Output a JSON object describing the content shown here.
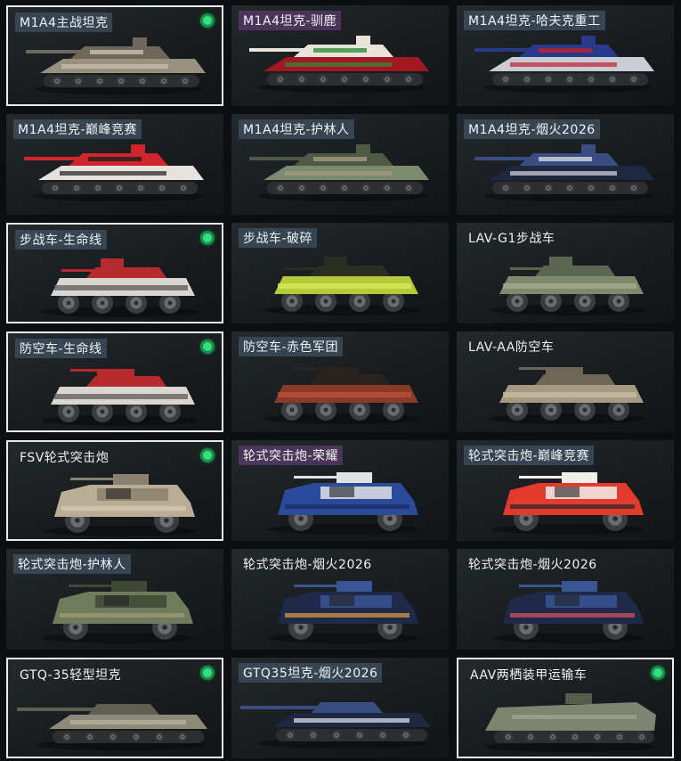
{
  "cards": [
    {
      "name": "M1A4主战坦克",
      "tag": "blue",
      "selected": true,
      "equipped": true,
      "kind": "tank",
      "body": "#9a9080",
      "accent": "#6e675c",
      "mark": "#c9c2b2"
    },
    {
      "name": "M1A4坦克-驯鹿",
      "tag": "purple",
      "selected": false,
      "equipped": false,
      "kind": "tank",
      "body": "#a11820",
      "accent": "#e8e4dc",
      "mark": "#2f8f3a"
    },
    {
      "name": "M1A4坦克-哈夫克重工",
      "tag": "blue",
      "selected": false,
      "equipped": false,
      "kind": "tank",
      "body": "#c9ccd3",
      "accent": "#2a3a8a",
      "mark": "#c02030"
    },
    {
      "name": "M1A4坦克-巅峰竞赛",
      "tag": "blue",
      "selected": false,
      "equipped": false,
      "kind": "tank",
      "body": "#e6e3de",
      "accent": "#d0262b",
      "mark": "#1e1e1e"
    },
    {
      "name": "M1A4坦克-护林人",
      "tag": "blue",
      "selected": false,
      "equipped": false,
      "kind": "tank",
      "body": "#7c8a70",
      "accent": "#4e5a45",
      "mark": "#a59a80"
    },
    {
      "name": "M1A4坦克-烟火2026",
      "tag": "blue",
      "selected": false,
      "equipped": false,
      "kind": "tank",
      "body": "#1d2740",
      "accent": "#3a4d80",
      "mark": "#d8d8e0"
    },
    {
      "name": "步战车-生命线",
      "tag": "blue",
      "selected": true,
      "equipped": true,
      "kind": "ifv",
      "body": "#d9d6d2",
      "accent": "#b52a2f",
      "mark": "#5a5a5a"
    },
    {
      "name": "步战车-破碎",
      "tag": "blue",
      "selected": false,
      "equipped": false,
      "kind": "ifv",
      "body": "#b6c93a",
      "accent": "#2a2f22",
      "mark": "#d9ea5a"
    },
    {
      "name": "LAV-G1步战车",
      "tag": "plain",
      "selected": false,
      "equipped": false,
      "kind": "ifv",
      "body": "#7f8a6c",
      "accent": "#5c6650",
      "mark": "#a6ad94"
    },
    {
      "name": "防空车-生命线",
      "tag": "blue",
      "selected": true,
      "equipped": true,
      "kind": "aa",
      "body": "#d9d6d2",
      "accent": "#b52a2f",
      "mark": "#5a5a5a"
    },
    {
      "name": "防空车-赤色军团",
      "tag": "blue",
      "selected": false,
      "equipped": false,
      "kind": "aa",
      "body": "#8a3a28",
      "accent": "#2a221e",
      "mark": "#c0503a"
    },
    {
      "name": "LAV-AA防空车",
      "tag": "plain",
      "selected": false,
      "equipped": false,
      "kind": "aa",
      "body": "#a59a82",
      "accent": "#6e6656",
      "mark": "#c8bea6"
    },
    {
      "name": "FSV轮式突击炮",
      "tag": "plain",
      "selected": true,
      "equipped": true,
      "kind": "fsv",
      "body": "#b9ad96",
      "accent": "#8a8070",
      "mark": "#d6ccb6"
    },
    {
      "name": "轮式突击炮-荣耀",
      "tag": "purple",
      "selected": false,
      "equipped": false,
      "kind": "fsv",
      "body": "#2b4a9a",
      "accent": "#e2e2e6",
      "mark": "#1a2a60"
    },
    {
      "name": "轮式突击炮-巅峰竞赛",
      "tag": "blue",
      "selected": false,
      "equipped": false,
      "kind": "fsv",
      "body": "#e23a2c",
      "accent": "#f1efea",
      "mark": "#2a2a2a"
    },
    {
      "name": "轮式突击炮-护林人",
      "tag": "blue",
      "selected": false,
      "equipped": false,
      "kind": "fsv",
      "body": "#6e7c5c",
      "accent": "#3e4834",
      "mark": "#a29878"
    },
    {
      "name": "轮式突击炮-烟火2026",
      "tag": "plain",
      "selected": false,
      "equipped": false,
      "kind": "fsv",
      "body": "#1e2a48",
      "accent": "#3b5594",
      "mark": "#e0a040"
    },
    {
      "name": "轮式突击炮-烟火2026",
      "tag": "plain",
      "selected": false,
      "equipped": false,
      "kind": "fsv",
      "body": "#1e2a48",
      "accent": "#3b5594",
      "mark": "#e05060"
    },
    {
      "name": "GTQ-35轻型坦克",
      "tag": "plain",
      "selected": true,
      "equipped": true,
      "kind": "light",
      "body": "#8e8a7a",
      "accent": "#615e52",
      "mark": "#b7b2a0"
    },
    {
      "name": "GTQ35坦克-烟火2026",
      "tag": "blue",
      "selected": false,
      "equipped": false,
      "kind": "light",
      "body": "#1d2740",
      "accent": "#3a4d80",
      "mark": "#dcdce6"
    },
    {
      "name": "AAV两栖装甲运输车",
      "tag": "plain",
      "selected": true,
      "equipped": true,
      "kind": "aav",
      "body": "#7d8470",
      "accent": "#555c4a",
      "mark": "#a2a892"
    }
  ]
}
